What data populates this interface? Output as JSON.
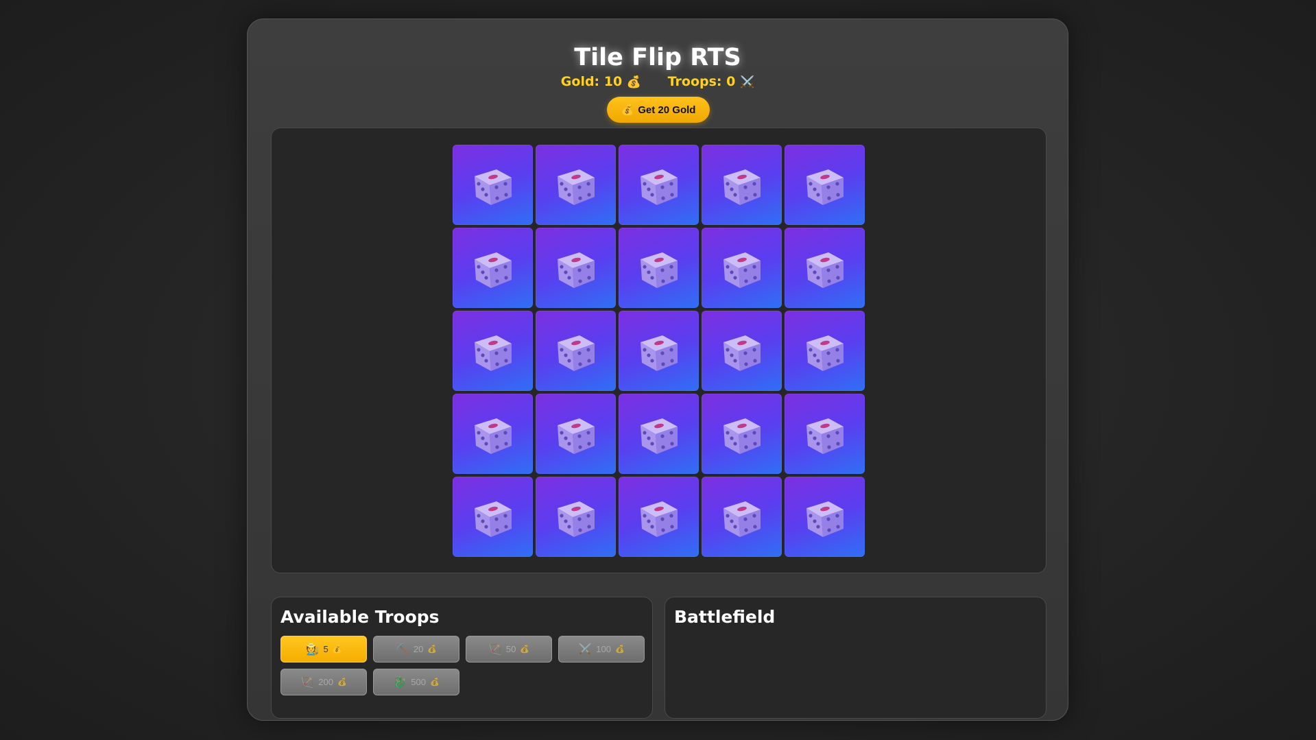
{
  "header": {
    "title": "Tile Flip RTS",
    "gold_label": "Gold:",
    "gold_value": "10",
    "gold_icon": "💰",
    "troops_label": "Troops:",
    "troops_value": "0",
    "troops_icon": "⚔️"
  },
  "gold_button": {
    "icon": "💰",
    "label": "Get 20 Gold"
  },
  "board": {
    "rows": 5,
    "cols": 5,
    "tile_icon": "dice-icon"
  },
  "troops_panel": {
    "title": "Available Troops",
    "coin_icon": "💰",
    "troops": [
      {
        "icon": "🧑‍🌾",
        "icon_name": "peasant-icon",
        "cost": "5",
        "available": true
      },
      {
        "icon": "⛏️",
        "icon_name": "pickaxe-icon",
        "cost": "20",
        "available": false
      },
      {
        "icon": "🏹",
        "icon_name": "archer-icon",
        "cost": "50",
        "available": false
      },
      {
        "icon": "⚔️",
        "icon_name": "swords-icon",
        "cost": "100",
        "available": false
      },
      {
        "icon": "🏹",
        "icon_name": "crossbow-icon",
        "cost": "200",
        "available": false
      },
      {
        "icon": "🐉",
        "icon_name": "dragon-icon",
        "cost": "500",
        "available": false
      }
    ]
  },
  "battlefield_panel": {
    "title": "Battlefield"
  },
  "colors": {
    "accent": "#ffc21c",
    "tile_top": "#7c2fe0",
    "tile_bottom": "#2f6ff4",
    "stat_text": "#ffd21f"
  }
}
